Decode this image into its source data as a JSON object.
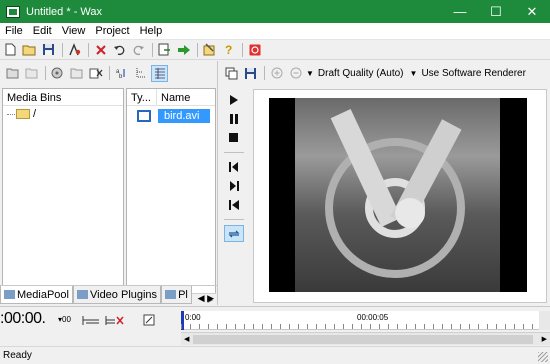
{
  "window": {
    "title": "Untitled * - Wax",
    "minimize_label": "—",
    "maximize_label": "☐",
    "close_label": "✕"
  },
  "menu": [
    "File",
    "Edit",
    "View",
    "Project",
    "Help"
  ],
  "toolbar_main": {
    "icons": [
      "new-icon",
      "open-icon",
      "save-icon",
      "properties-icon",
      "delete-icon",
      "undo-icon",
      "redo-icon",
      "export-icon",
      "render-icon",
      "settings-icon",
      "help-icon",
      "record-icon"
    ]
  },
  "left_panel": {
    "bins_header": "Media Bins",
    "bins_root": "/",
    "files_columns": {
      "type": "Ty...",
      "name": "Name"
    },
    "files": [
      {
        "name": "bird.avi"
      }
    ]
  },
  "bottom_tabs": [
    "MediaPool",
    "Video Plugins",
    "Pl"
  ],
  "preview_toolbar": {
    "quality": "Draft Quality (Auto)",
    "renderer": "Use Software Renderer"
  },
  "timeline": {
    "timecode": ":00:00.",
    "timecode_unit": "00",
    "ruler_start": "0:00",
    "ruler_mark": "00:00:05"
  },
  "status": {
    "text": "Ready"
  }
}
